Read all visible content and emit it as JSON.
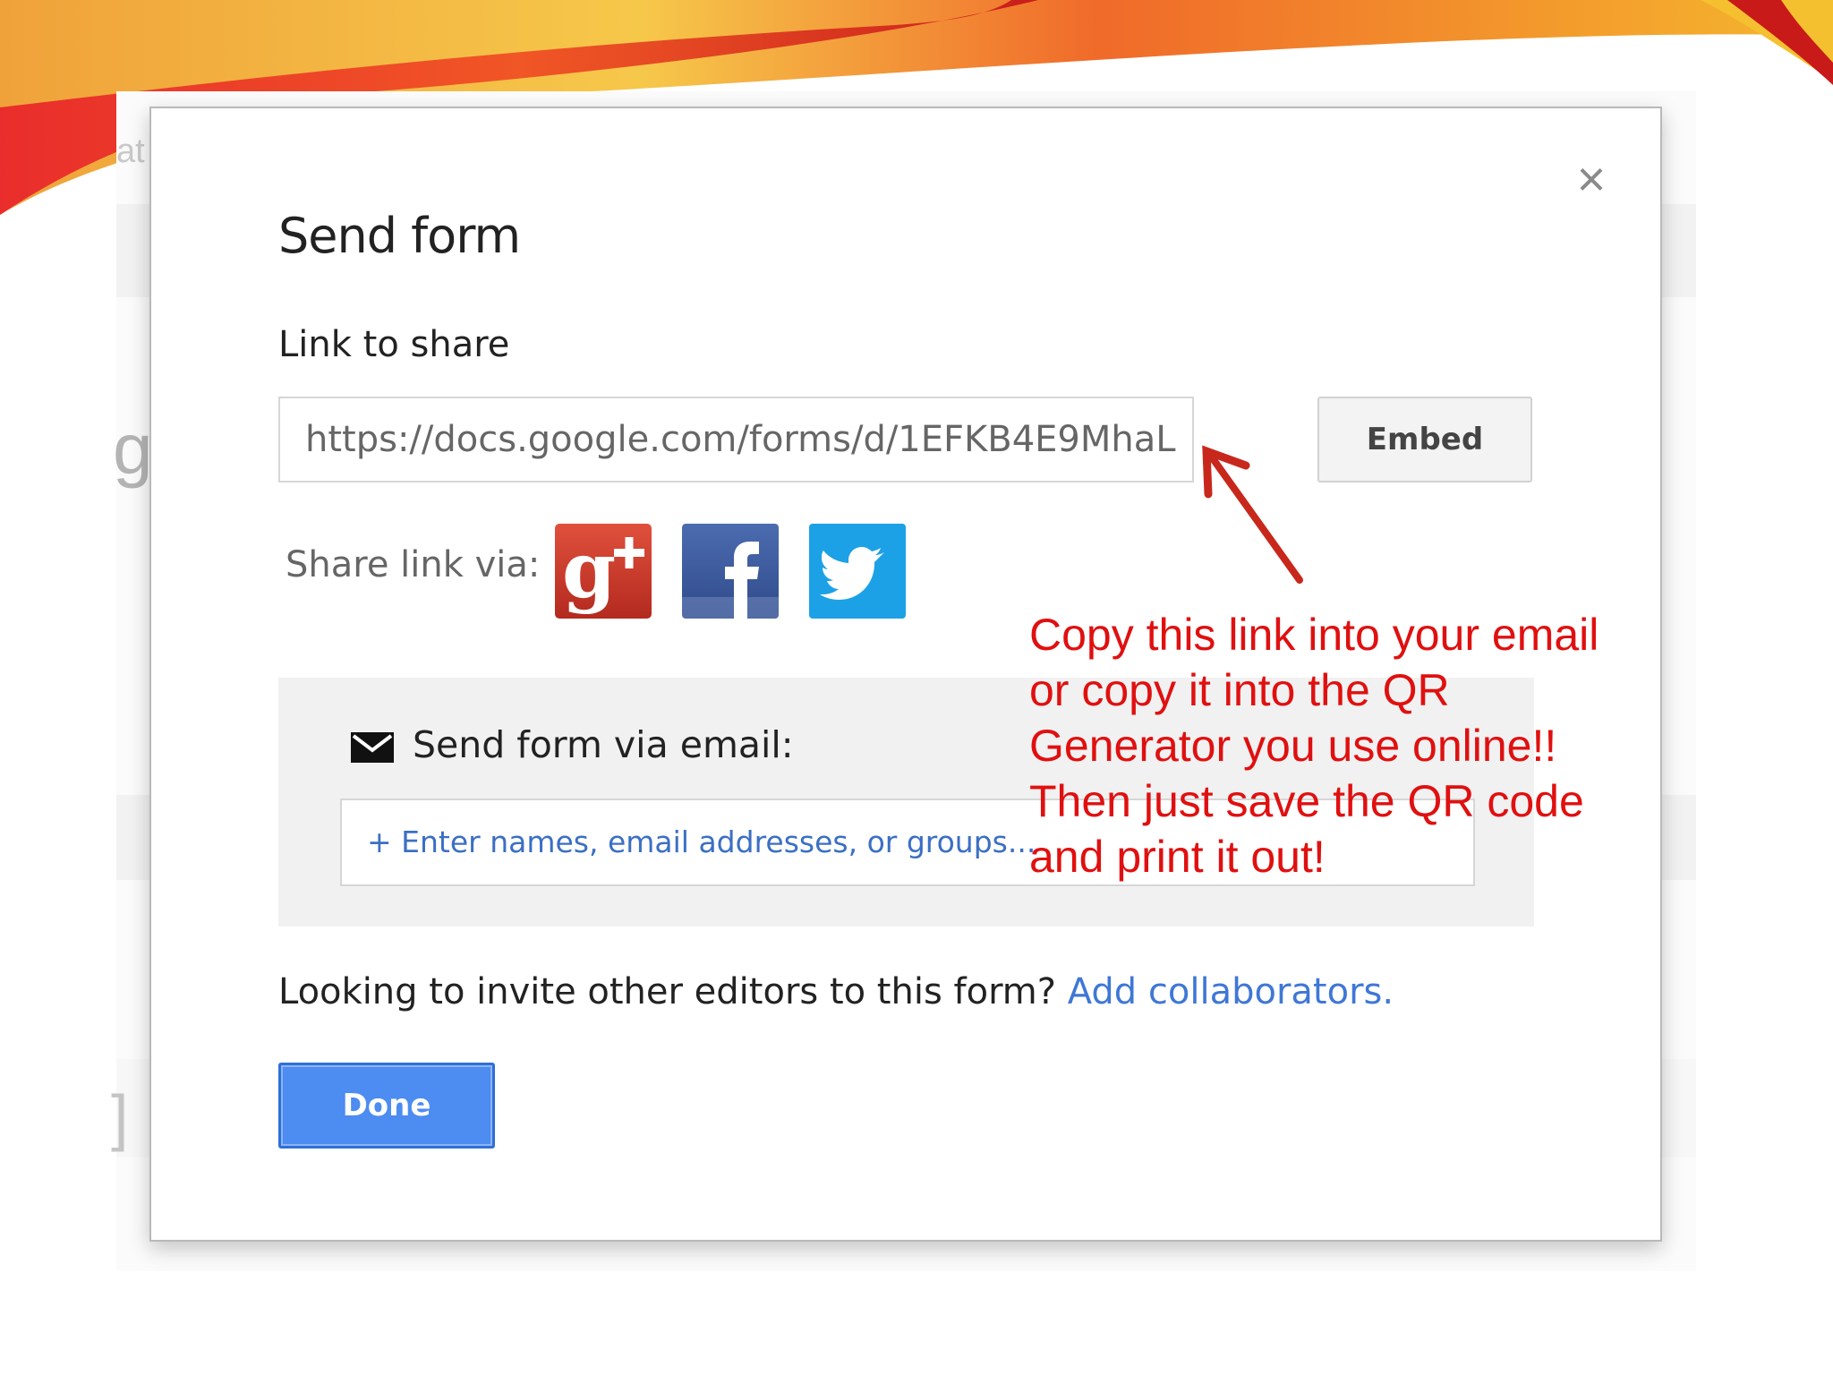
{
  "dialog": {
    "title": "Send form",
    "close_glyph": "×",
    "link_label": "Link to share",
    "link_value": "https://docs.google.com/forms/d/1EFKB4E9MhaL",
    "embed_label": "Embed",
    "share_label": "Share link via:",
    "share_icons": [
      "google-plus-icon",
      "facebook-icon",
      "twitter-icon"
    ],
    "email_label": "Send form via email:",
    "email_placeholder": "+ Enter names, email addresses, or groups...",
    "invite_text": "Looking to invite other editors to this form?",
    "invite_link": "Add collaborators.",
    "done_label": "Done"
  },
  "background": {
    "fragment_1": "at",
    "fragment_2": "g",
    "fragment_3": "]"
  },
  "annotation": {
    "lines": [
      "Copy this link into your email",
      "or copy it into the QR",
      "Generator you use online!!",
      "Then just save the QR code",
      "and print it out!"
    ]
  },
  "colors": {
    "primary_button": "#4d8cf0",
    "link": "#3f77d6",
    "annotation": "#e01010",
    "google_plus": "#d23a2a",
    "facebook": "#3b5998",
    "twitter": "#1da1e6"
  }
}
